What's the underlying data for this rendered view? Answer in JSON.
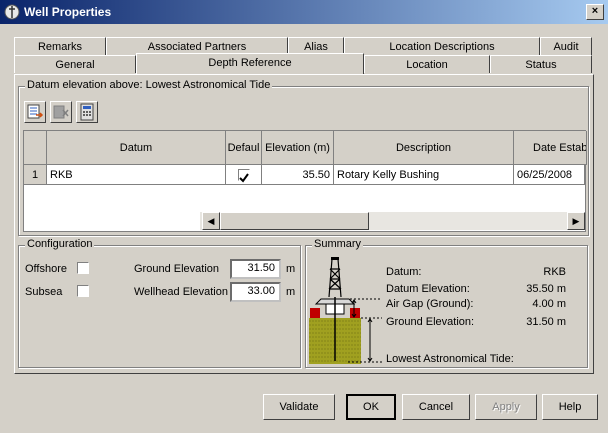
{
  "window": {
    "title": "Well Properties",
    "close_glyph": "×"
  },
  "tabs": {
    "row_back": [
      "Remarks",
      "Associated Partners",
      "Alias",
      "Location Descriptions",
      "Audit"
    ],
    "row_front": [
      "General",
      "Depth Reference",
      "Location",
      "Status"
    ],
    "active": "Depth Reference"
  },
  "datum_group": {
    "title": "Datum elevation above: Lowest Astronomical Tide",
    "toolbar_icons": [
      "add-row-icon",
      "delete-row-icon",
      "calculator-icon"
    ]
  },
  "grid": {
    "columns": [
      "Datum",
      "Defaul",
      "Elevation (m)",
      "Description",
      "Date Establishe"
    ],
    "rows": [
      {
        "index": "1",
        "datum": "RKB",
        "default": true,
        "elevation": "35.50",
        "description": "Rotary Kelly Bushing",
        "date": "06/25/2008"
      }
    ]
  },
  "configuration": {
    "title": "Configuration",
    "offshore_label": "Offshore",
    "subsea_label": "Subsea",
    "offshore_checked": false,
    "subsea_checked": false,
    "ground_label": "Ground Elevation",
    "ground_value": "31.50",
    "ground_unit": "m",
    "wellhead_label": "Wellhead Elevation",
    "wellhead_value": "33.00",
    "wellhead_unit": "m"
  },
  "summary": {
    "title": "Summary",
    "rows": [
      {
        "label": "Datum:",
        "value": "RKB"
      },
      {
        "label": "Datum Elevation:",
        "value": "35.50 m"
      },
      {
        "label": "Air Gap (Ground):",
        "value": "4.00 m"
      },
      {
        "label": "Ground Elevation:",
        "value": "31.50 m"
      }
    ],
    "bottom_label": "Lowest Astronomical Tide:"
  },
  "buttons": {
    "validate": "Validate",
    "ok": "OK",
    "cancel": "Cancel",
    "apply": "Apply",
    "help": "Help"
  }
}
